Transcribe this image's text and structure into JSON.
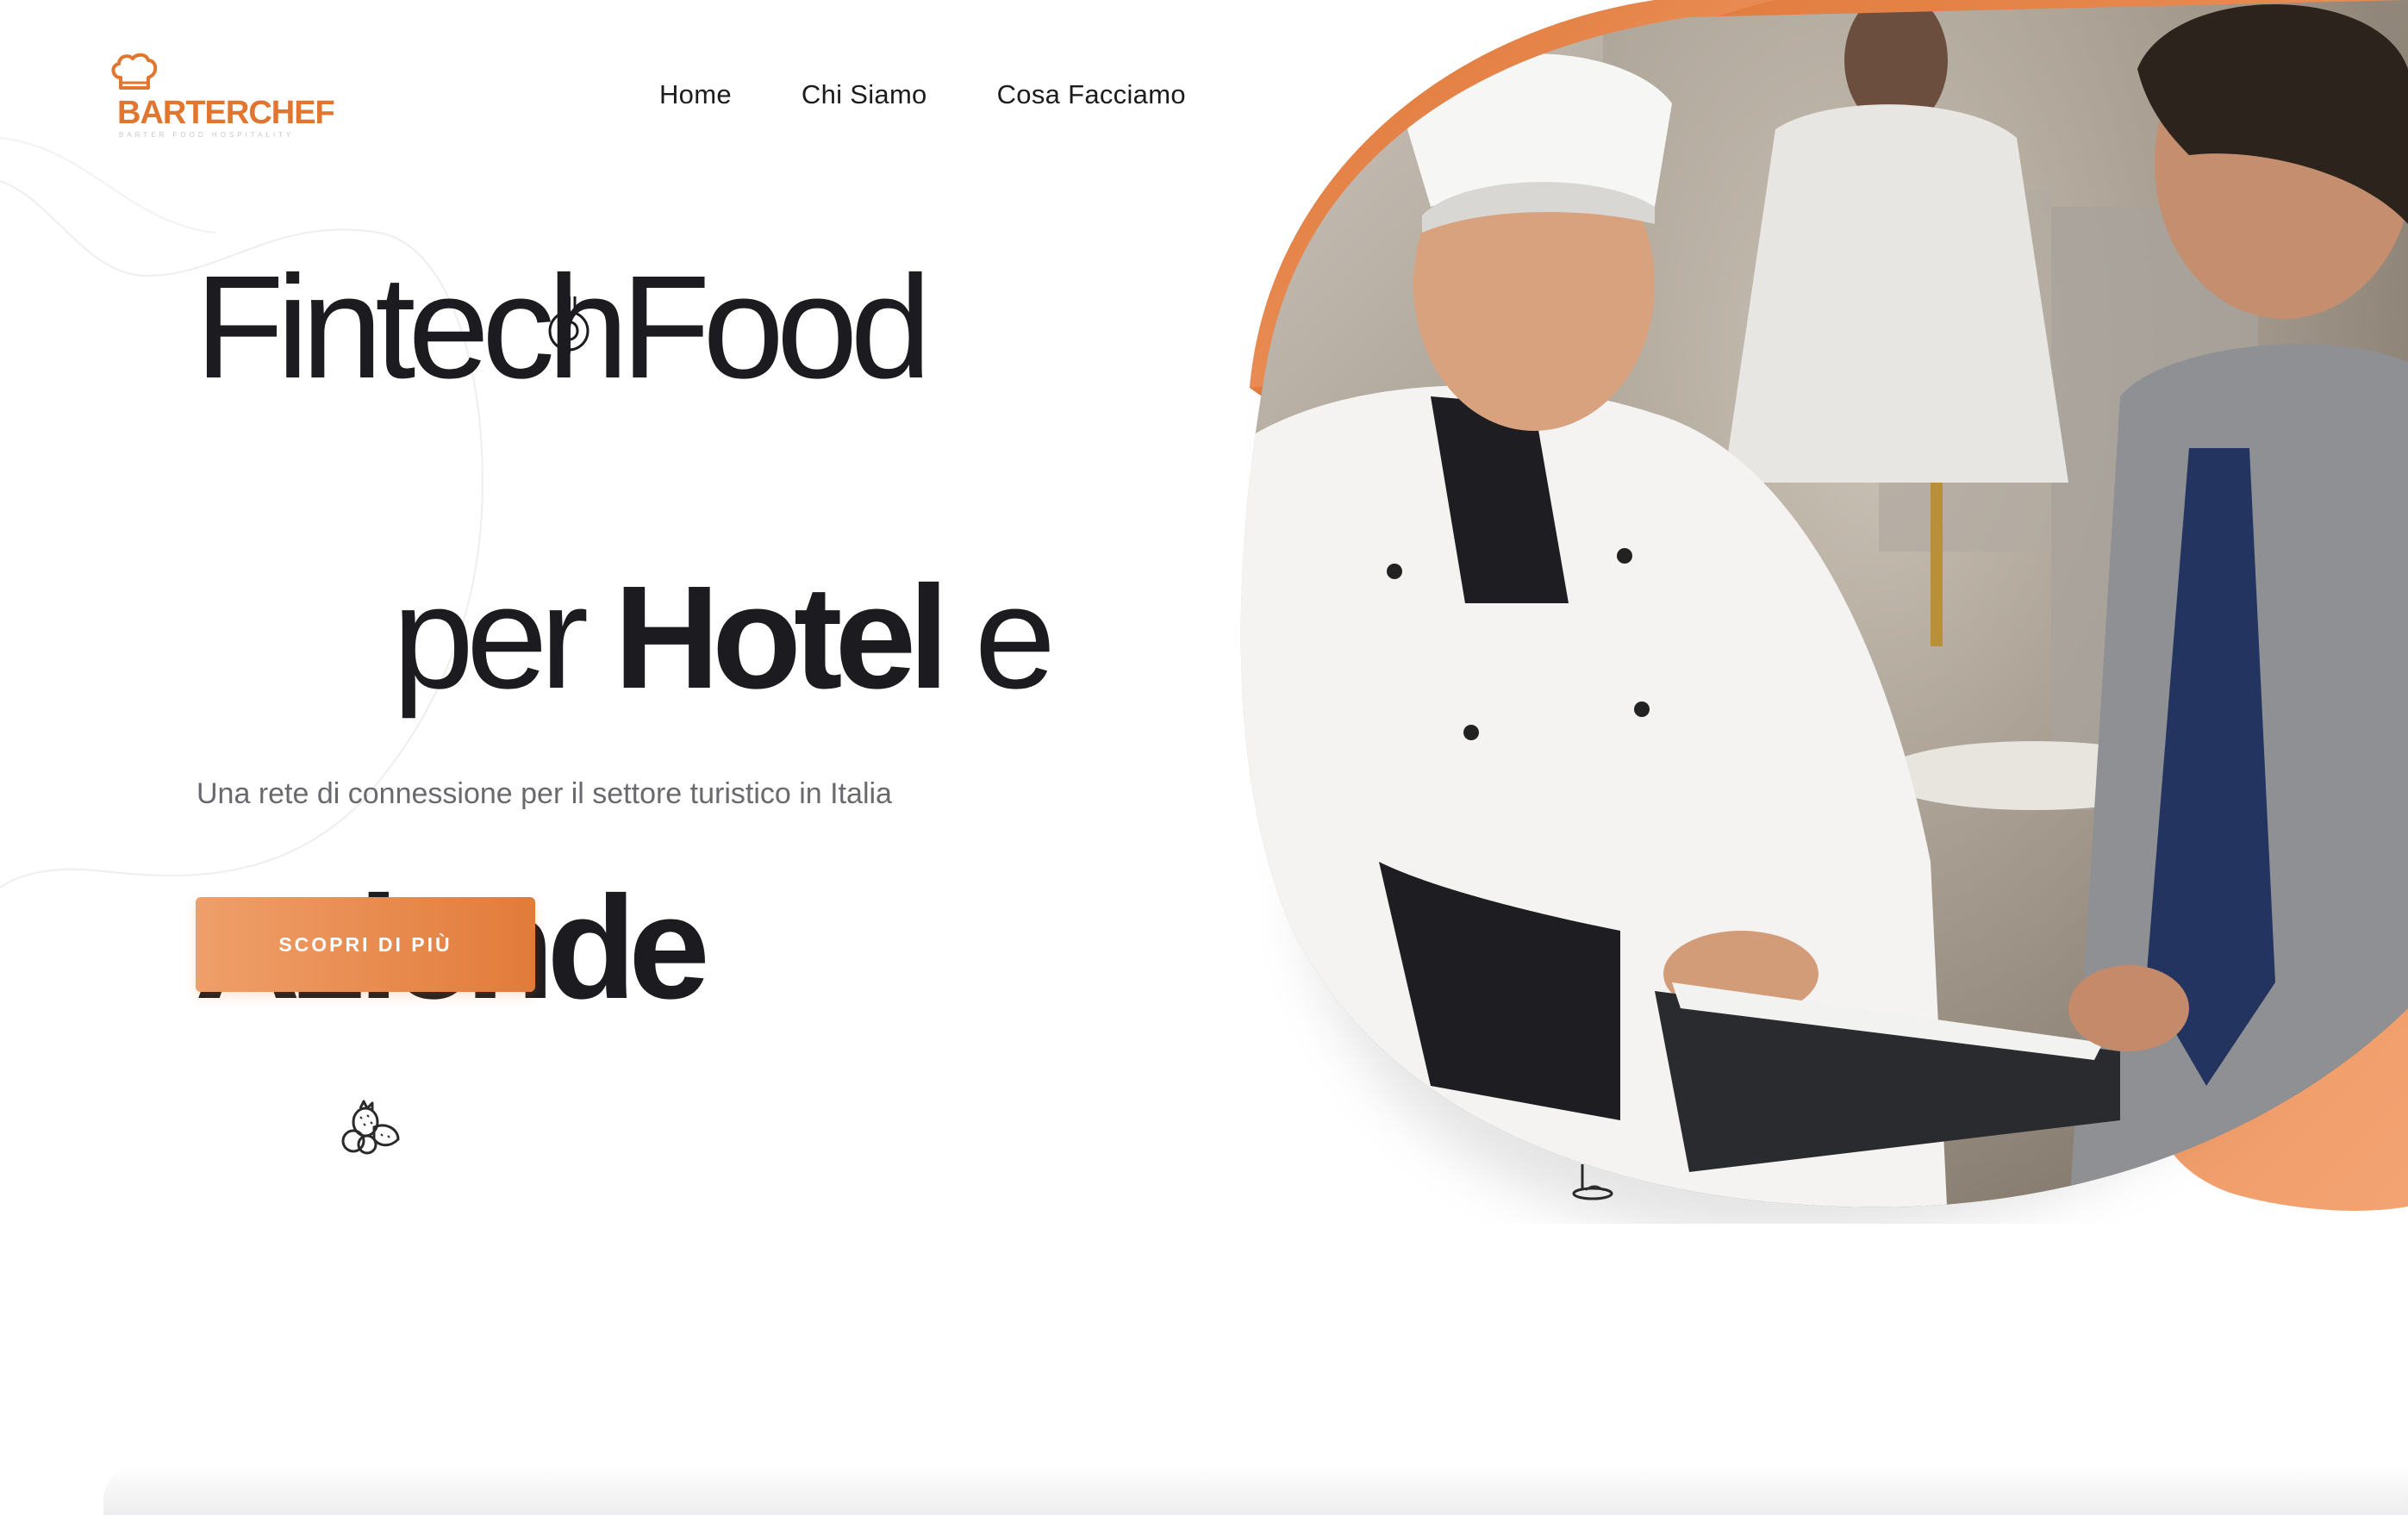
{
  "brand": {
    "name_part1": "BARTER",
    "name_part2": "CHEF",
    "tagline": "BARTER FOOD HOSPITALITY",
    "accent_color": "#e0762f",
    "logo_icon": "chef-hat-icon"
  },
  "nav": {
    "items": [
      {
        "label": "Home"
      },
      {
        "label": "Chi Siamo"
      },
      {
        "label": "Cosa Facciamo"
      }
    ]
  },
  "hero": {
    "headline_line1": "FintechFood",
    "headline_line2_light": "per ",
    "headline_line2_bold": "Hotel",
    "headline_line2_end": " e",
    "headline_line3_bold": "Aziende",
    "subtitle": "Una rete di connessione per il settore turistico in Italia",
    "cta_label": "SCOPRI DI PIÙ",
    "image_description_icon": "chef-and-manager-photo",
    "decor_icons": [
      "fork-spaghetti-icon",
      "fruit-icon",
      "scroll-down-icon"
    ]
  },
  "colors": {
    "accent_light": "#ef9f6a",
    "accent_dark": "#e27b3a",
    "text_dark": "#1c1c20",
    "text_muted": "#6a6a6e"
  }
}
